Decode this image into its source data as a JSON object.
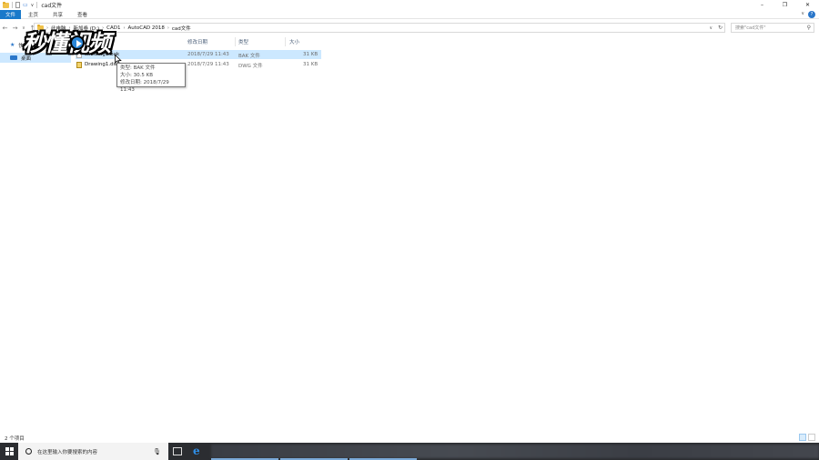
{
  "window": {
    "title": "cad文件",
    "controls": {
      "minimize": "–",
      "maximize": "❐",
      "close": "✕"
    }
  },
  "ribbon": {
    "tabs": [
      "文件",
      "主页",
      "共享",
      "查看"
    ],
    "help": "?",
    "collapse": "∨"
  },
  "address": {
    "breadcrumb": [
      "此电脑",
      "新加卷 (D:)",
      "CAD1",
      "AutoCAD 2018",
      "cad文件"
    ],
    "search_placeholder": "搜索\"cad文件\""
  },
  "nav": {
    "quick_access": "快速访问",
    "desktop": "桌面"
  },
  "watermark": {
    "text": "秒懂视频",
    "icon": "play-icon"
  },
  "columns": {
    "date": "修改日期",
    "type": "类型",
    "size": "大小"
  },
  "files": [
    {
      "name": "Drawing1.bak",
      "date": "2018/7/29 11:43",
      "type": "BAK 文件",
      "size": "31 KB",
      "selected": true
    },
    {
      "name": "Drawing1.dwg",
      "date": "2018/7/29 11:43",
      "type": "DWG 文件",
      "size": "31 KB",
      "selected": false
    }
  ],
  "tooltip": {
    "type_line": "类型: BAK 文件",
    "size_line": "大小: 30.5 KB",
    "date_line": "修改日期: 2018/7/29 11:43"
  },
  "status": {
    "item_count": "2 个项目"
  },
  "taskbar": {
    "search_placeholder": "在这里输入你要搜索的内容"
  },
  "colors": {
    "accent": "#1979ca",
    "selection": "#cce8ff",
    "taskbar": "#2b2d31"
  }
}
